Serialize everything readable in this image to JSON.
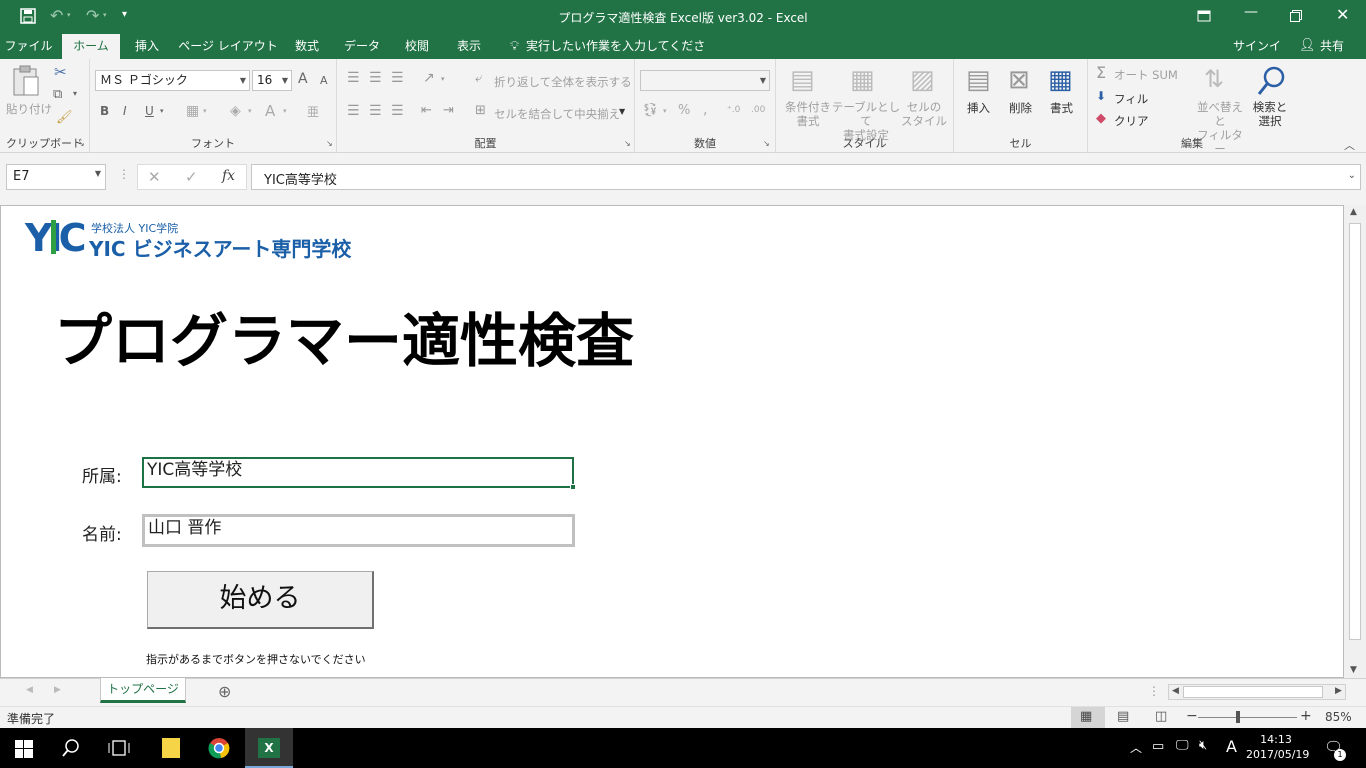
{
  "window": {
    "title": "プログラマ適性検査 Excel版 ver3.02 - Excel"
  },
  "ribbon_tabs": {
    "file": "ファイル",
    "home": "ホーム",
    "insert": "挿入",
    "page_layout": "ページ レイアウト",
    "formulas": "数式",
    "data": "データ",
    "review": "校閲",
    "view": "表示",
    "tell_me": "実行したい作業を入力してください...",
    "signin": "サインイン",
    "share": "共有"
  },
  "ribbon": {
    "clipboard": {
      "paste": "貼り付け",
      "group": "クリップボード"
    },
    "font": {
      "name": "ＭＳ Ｐゴシック",
      "size": "16",
      "group": "フォント",
      "bold": "B",
      "italic": "I",
      "underline": "U",
      "grow": "A",
      "shrink": "A"
    },
    "alignment": {
      "wrap": "折り返して全体を表示する",
      "merge": "セルを結合して中央揃え",
      "group": "配置"
    },
    "number": {
      "format": "",
      "percent": "%",
      "comma": ",",
      "group": "数値"
    },
    "styles": {
      "conditional": "条件付き\n書式",
      "table": "テーブルとして\n書式設定",
      "cell_styles": "セルの\nスタイル",
      "group": "スタイル"
    },
    "cells": {
      "insert": "挿入",
      "delete": "削除",
      "format": "書式",
      "group": "セル"
    },
    "editing": {
      "autosum": "オート SUM",
      "fill": "フィル",
      "clear": "クリア",
      "sort": "並べ替えと\nフィルター",
      "find": "検索と\n選択",
      "group": "編集"
    }
  },
  "formula_bar": {
    "name_box": "E7",
    "fx": "fx",
    "value": "YIC高等学校"
  },
  "sheet": {
    "logo": {
      "small": "学校法人 YIC学院",
      "big": "YIC ビジネスアート専門学校",
      "mark": "YIC"
    },
    "title": "プログラマー適性検査",
    "affiliation_label": "所属:",
    "affiliation_value": "YIC高等学校",
    "name_label": "名前:",
    "name_value": "山口 晋作",
    "start_button": "始める",
    "note": "指示があるまでボタンを押さないでください"
  },
  "sheet_tabs": {
    "active": "トップページ"
  },
  "status": {
    "ready": "準備完了",
    "zoom": "85%"
  },
  "taskbar": {
    "time": "14:13",
    "date": "2017/05/19",
    "ime": "A",
    "notifications": "1"
  },
  "colors": {
    "excel_green": "#217346",
    "selection_green": "#1e7145",
    "logo_blue": "#1a5fa8",
    "logo_green": "#2ea043"
  }
}
